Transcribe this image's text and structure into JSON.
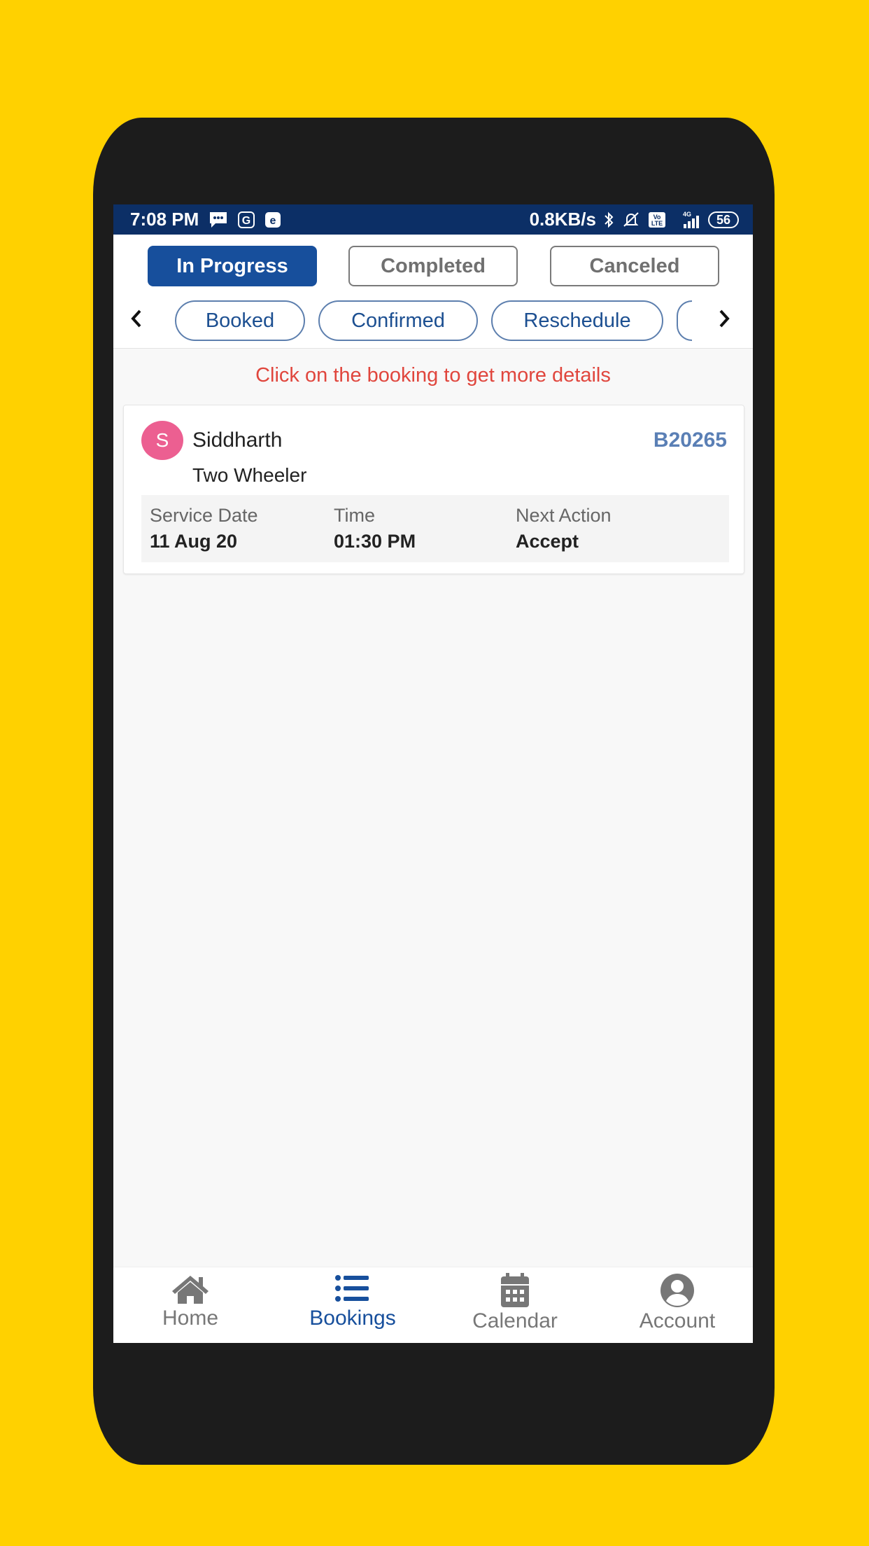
{
  "status_bar": {
    "time": "7:08 PM",
    "left_icons": [
      "message-icon",
      "app-g-icon",
      "app-e-icon"
    ],
    "network_speed": "0.8KB/s",
    "right_icons": [
      "bluetooth-icon",
      "silent-bell-icon",
      "volte-icon",
      "signal-4g-icon"
    ],
    "network_type": "4G",
    "volte_label": "Vo LTE",
    "battery": "56"
  },
  "tabs": [
    {
      "label": "In Progress",
      "active": true
    },
    {
      "label": "Completed",
      "active": false
    },
    {
      "label": "Canceled",
      "active": false
    }
  ],
  "filters": {
    "prev_icon": "chevron-left-icon",
    "next_icon": "chevron-right-icon",
    "chips": [
      "Booked",
      "Confirmed",
      "Reschedule"
    ]
  },
  "hint": "Click on the booking to get more details",
  "bookings": [
    {
      "avatar_letter": "S",
      "customer": "Siddharth",
      "booking_id": "B20265",
      "vehicle": "Two Wheeler",
      "service_date_label": "Service Date",
      "service_date": "11 Aug 20",
      "time_label": "Time",
      "time": "01:30 PM",
      "next_action_label": "Next Action",
      "next_action": "Accept"
    }
  ],
  "bottom_nav": [
    {
      "label": "Home",
      "icon": "home-icon",
      "active": false
    },
    {
      "label": "Bookings",
      "icon": "list-icon",
      "active": true
    },
    {
      "label": "Calendar",
      "icon": "calendar-icon",
      "active": false
    },
    {
      "label": "Account",
      "icon": "account-icon",
      "active": false
    }
  ],
  "colors": {
    "background": "#FFD100",
    "status_bar": "#0c2f66",
    "primary": "#174f9c",
    "hint": "#e0463d",
    "avatar": "#ec5f91",
    "booking_id": "#5a7fb5"
  }
}
